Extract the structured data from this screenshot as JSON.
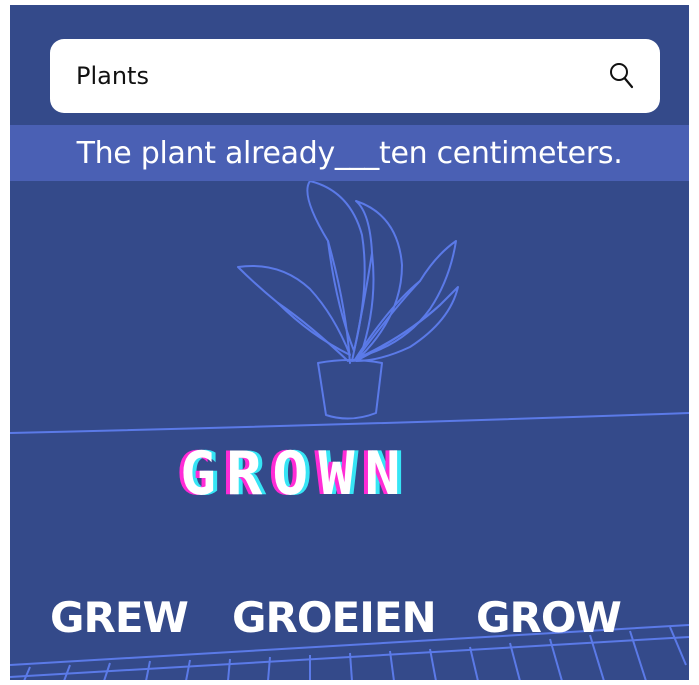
{
  "search": {
    "value": "Plants"
  },
  "question": {
    "text": "The plant already___ten centimeters."
  },
  "title_word": "GROWN",
  "options": [
    "GREW",
    "GROEIEN",
    "GROW"
  ],
  "colors": {
    "background": "#344a8a",
    "question_bar": "#4a60b4",
    "line_art": "#5b7ae8",
    "glitch_pink": "#ff2bd6",
    "glitch_cyan": "#36e5f5"
  },
  "icons": {
    "search": "magnifier-icon",
    "illustration": "potted-plant-icon"
  }
}
